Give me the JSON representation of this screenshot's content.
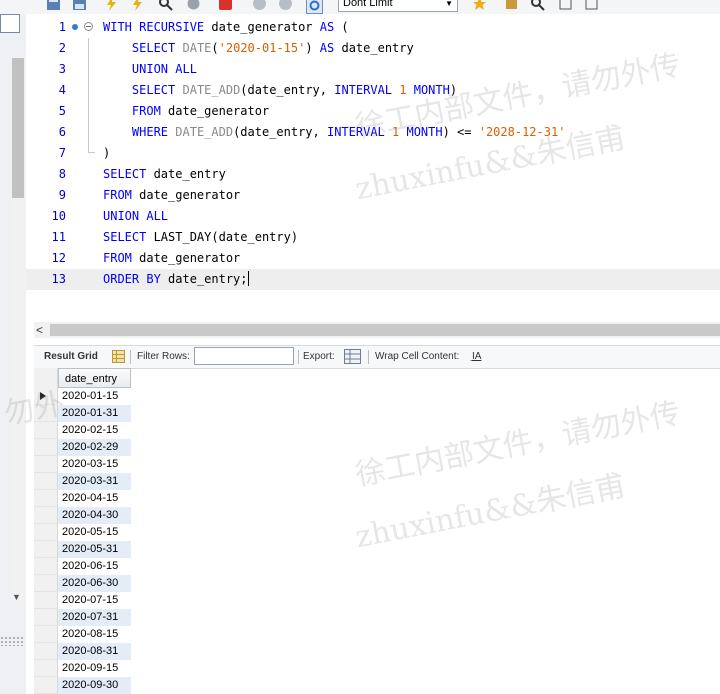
{
  "toolbar": {
    "limit_value": "Dont Limit",
    "icons": [
      "save-icon",
      "lightning-icon",
      "search-icon",
      "stop-icon",
      "cancel-icon",
      "check-icon",
      "x-icon",
      "refresh-icon",
      "star-icon",
      "books-icon",
      "magnifier-icon",
      "format-icon",
      "wrap-icon"
    ]
  },
  "editor": {
    "line_numbers": [
      "1",
      "2",
      "3",
      "4",
      "5",
      "6",
      "7",
      "8",
      "9",
      "10",
      "11",
      "12",
      "13"
    ]
  },
  "results": {
    "result_grid_label": "Result Grid",
    "filter_rows_label": "Filter Rows:",
    "filter_rows_value": "",
    "export_label": "Export:",
    "wrap_cell_label": "Wrap Cell Content:",
    "column_header": "date_entry",
    "rows": [
      "2020-01-15",
      "2020-01-31",
      "2020-02-15",
      "2020-02-29",
      "2020-03-15",
      "2020-03-31",
      "2020-04-15",
      "2020-04-30",
      "2020-05-15",
      "2020-05-31",
      "2020-06-15",
      "2020-06-30",
      "2020-07-15",
      "2020-07-31",
      "2020-08-15",
      "2020-08-31",
      "2020-09-15",
      "2020-09-30"
    ]
  },
  "watermark": {
    "line1": "徐工内部文件，请勿外传",
    "line2": "zhuxinfu&&朱信甫"
  },
  "colors": {
    "keyword": "#0000ff",
    "string": "#d75f00",
    "function": "#8a8a8a",
    "line_number": "#0000cc",
    "row_highlight": "#e3ecf7"
  }
}
